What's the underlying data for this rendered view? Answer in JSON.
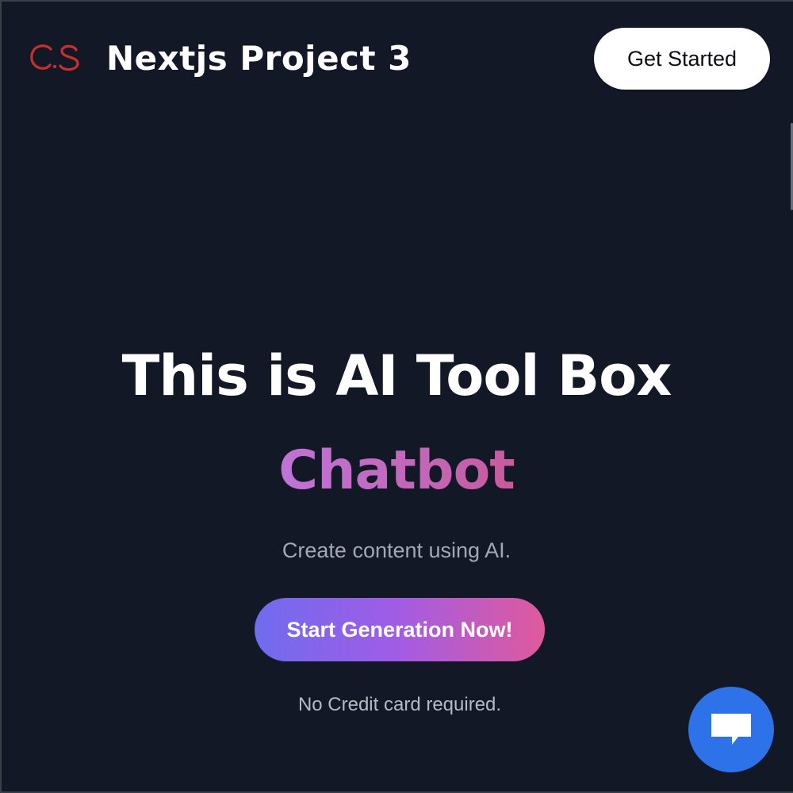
{
  "header": {
    "brand_title": "Nextjs Project 3",
    "logo_icon": "cs-logo-icon",
    "get_started_label": "Get Started"
  },
  "hero": {
    "title": "This is AI Tool Box",
    "highlight": "Chatbot",
    "subtitle": "Create content using AI.",
    "cta_label": "Start Generation Now!",
    "note": "No Credit card required."
  },
  "chat_widget": {
    "icon": "chat-icon"
  },
  "colors": {
    "background": "#131826",
    "logo_red": "#c8312b",
    "cta_gradient_start": "#6f6cee",
    "cta_gradient_mid": "#a05ce6",
    "cta_gradient_end": "#e05a9c",
    "highlight_purple": "#c070c8",
    "chat_blue": "#2d72e9"
  }
}
